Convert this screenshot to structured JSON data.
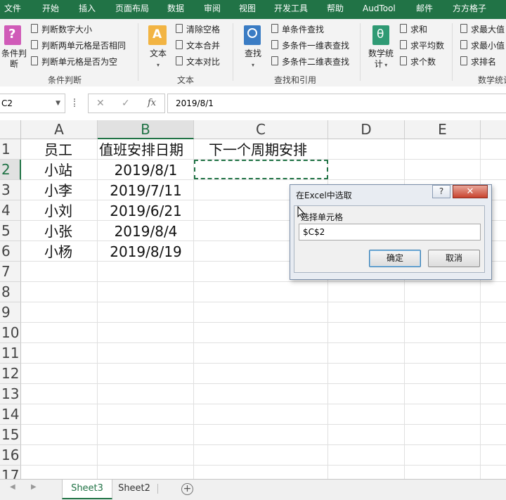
{
  "ribbon_tabs": [
    "文件",
    "开始",
    "插入",
    "页面布局",
    "数据",
    "审阅",
    "视图",
    "开发工具",
    "帮助",
    "AudTool",
    "邮件",
    "方方格子"
  ],
  "ribbon": {
    "cond_big_label": "条件判\n断",
    "cond_items": [
      "判断数字大小",
      "判断两单元格是否相同",
      "判断单元格是否为空"
    ],
    "cond_group": "条件判断",
    "text_big_label": "文本",
    "text_items": [
      "清除空格",
      "文本合并",
      "文本对比"
    ],
    "text_group": "文本",
    "find_big_label": "查找",
    "find_items": [
      "单条件查找",
      "多条件一维表查找",
      "多条件二维表查找"
    ],
    "find_group": "查找和引用",
    "stats_big_label": "数学统\n计",
    "stats_items": [
      "求和",
      "求平均数",
      "求个数"
    ],
    "extra_items": [
      "求最大值",
      "求最小值",
      "求排名"
    ],
    "stats_group": "数学统计"
  },
  "formula_bar": {
    "name_box": "C2",
    "fx_label": "fx",
    "value": "2019/8/1"
  },
  "grid": {
    "columns": [
      "A",
      "B",
      "C",
      "D",
      "E"
    ],
    "rows": [
      "1",
      "2",
      "3",
      "4",
      "5",
      "6",
      "7",
      "8",
      "9",
      "10",
      "11",
      "12",
      "13",
      "14",
      "15",
      "16",
      "17"
    ],
    "headers": [
      "员工",
      "值班安排日期",
      "下一个周期安排"
    ],
    "data": [
      {
        "name": "小站",
        "date": "2019/8/1"
      },
      {
        "name": "小李",
        "date": "2019/7/11"
      },
      {
        "name": "小刘",
        "date": "2019/6/21"
      },
      {
        "name": "小张",
        "date": "2019/8/4"
      },
      {
        "name": "小杨",
        "date": "2019/8/19"
      }
    ]
  },
  "sheets": [
    "Sheet3",
    "Sheet2"
  ],
  "add_sheet": "+",
  "dialog": {
    "title": "在Excel中选取",
    "help": "?",
    "close": "✕",
    "prompt": "选择单元格",
    "value": "$C$2",
    "ok": "确定",
    "cancel": "取消"
  },
  "colors": {
    "accent": "#217346",
    "dialog_close": "#c8432e"
  },
  "icons": [
    "cond-judge-icon",
    "text-icon",
    "find-icon",
    "math-stats-icon",
    "checkbox-icon"
  ]
}
